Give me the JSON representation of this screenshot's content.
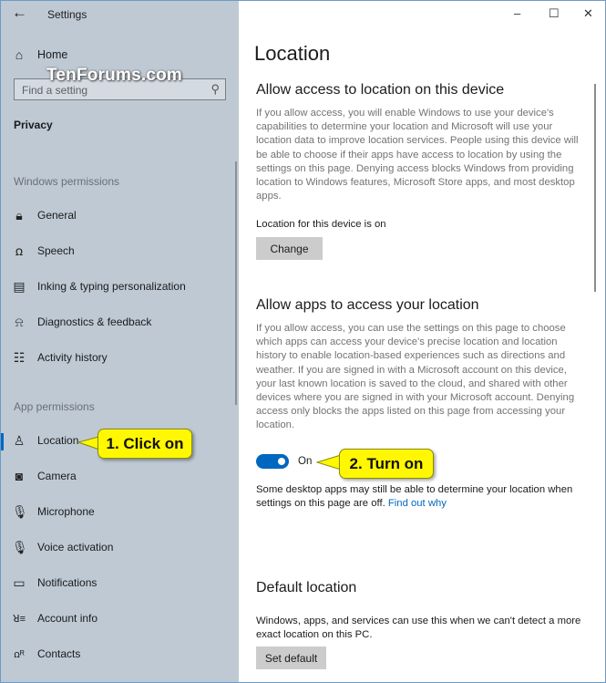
{
  "window": {
    "title": "Settings",
    "back_icon": "back-arrow-icon",
    "controls": {
      "minimize": "–",
      "maximize": "☐",
      "close": "✕"
    }
  },
  "watermark": "TenForums.com",
  "sidebar": {
    "home_label": "Home",
    "search_placeholder": "Find a setting",
    "category": "Privacy",
    "windows_permissions_header": "Windows permissions",
    "windows_permissions": [
      {
        "label": "General",
        "icon": "lock-icon"
      },
      {
        "label": "Speech",
        "icon": "speech-icon"
      },
      {
        "label": "Inking & typing personalization",
        "icon": "clipboard-icon"
      },
      {
        "label": "Diagnostics & feedback",
        "icon": "feedback-icon"
      },
      {
        "label": "Activity history",
        "icon": "activity-history-icon"
      }
    ],
    "app_permissions_header": "App permissions",
    "app_permissions": [
      {
        "label": "Location",
        "icon": "location-icon",
        "selected": true
      },
      {
        "label": "Camera",
        "icon": "camera-icon"
      },
      {
        "label": "Microphone",
        "icon": "microphone-icon"
      },
      {
        "label": "Voice activation",
        "icon": "microphone-icon"
      },
      {
        "label": "Notifications",
        "icon": "notification-icon"
      },
      {
        "label": "Account info",
        "icon": "account-info-icon"
      },
      {
        "label": "Contacts",
        "icon": "contacts-icon"
      }
    ]
  },
  "main": {
    "page_title": "Location",
    "device_section": {
      "heading": "Allow access to location on this device",
      "description": "If you allow access, you will enable Windows to use your device's capabilities to determine your location and Microsoft will use your location data to improve location services. People using this device will be able to choose if their apps have access to location by using the settings on this page. Denying access blocks Windows from providing location to Windows features, Microsoft Store apps, and most desktop apps.",
      "status": "Location for this device is on",
      "button": "Change"
    },
    "apps_section": {
      "heading": "Allow apps to access your location",
      "description": "If you allow access, you can use the settings on this page to choose which apps can access your device's precise location and location history to enable location-based experiences such as directions and weather. If you are signed in with a Microsoft account on this device, your last known location is saved to the cloud, and shared with other devices where you are signed in with your Microsoft account. Denying access only blocks the apps listed on this page from accessing your location.",
      "toggle_state": "On",
      "toggle_on": true,
      "note": "Some desktop apps may still be able to determine your location when settings on this page are off.",
      "link": "Find out why"
    },
    "default_section": {
      "heading": "Default location",
      "description": "Windows, apps, and services can use this when we can't detect a more exact location on this PC.",
      "button": "Set default"
    }
  },
  "callouts": {
    "step1": "1. Click on",
    "step2": "2. Turn on"
  },
  "colors": {
    "accent": "#0067c0",
    "sidebar_bg": "#bec9d4",
    "callout_bg": "#fff800"
  }
}
